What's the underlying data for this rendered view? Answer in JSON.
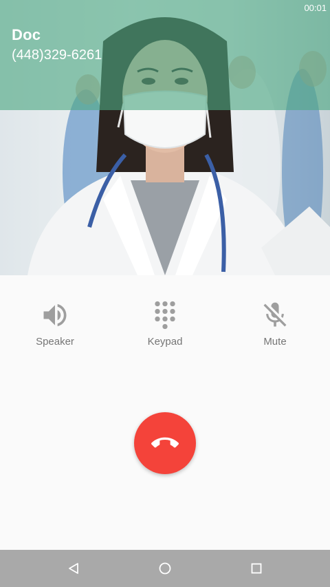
{
  "status_bar": {
    "time": "00:01"
  },
  "caller": {
    "name": "Doc",
    "number": "(448)329-6261"
  },
  "controls": [
    {
      "label": "Speaker",
      "icon": "speaker-icon"
    },
    {
      "label": "Keypad",
      "icon": "dialpad-icon"
    },
    {
      "label": "Mute",
      "icon": "mic-off-icon"
    }
  ],
  "end_call": {
    "icon": "hang-up-icon",
    "color": "#f4433a"
  },
  "nav": {
    "icons": [
      "back-icon",
      "home-icon",
      "recents-icon"
    ],
    "color": "#a9a9a9"
  },
  "colors": {
    "overlay": "#4da882",
    "icon_gray": "#9e9e9e",
    "label_gray": "#757575"
  }
}
